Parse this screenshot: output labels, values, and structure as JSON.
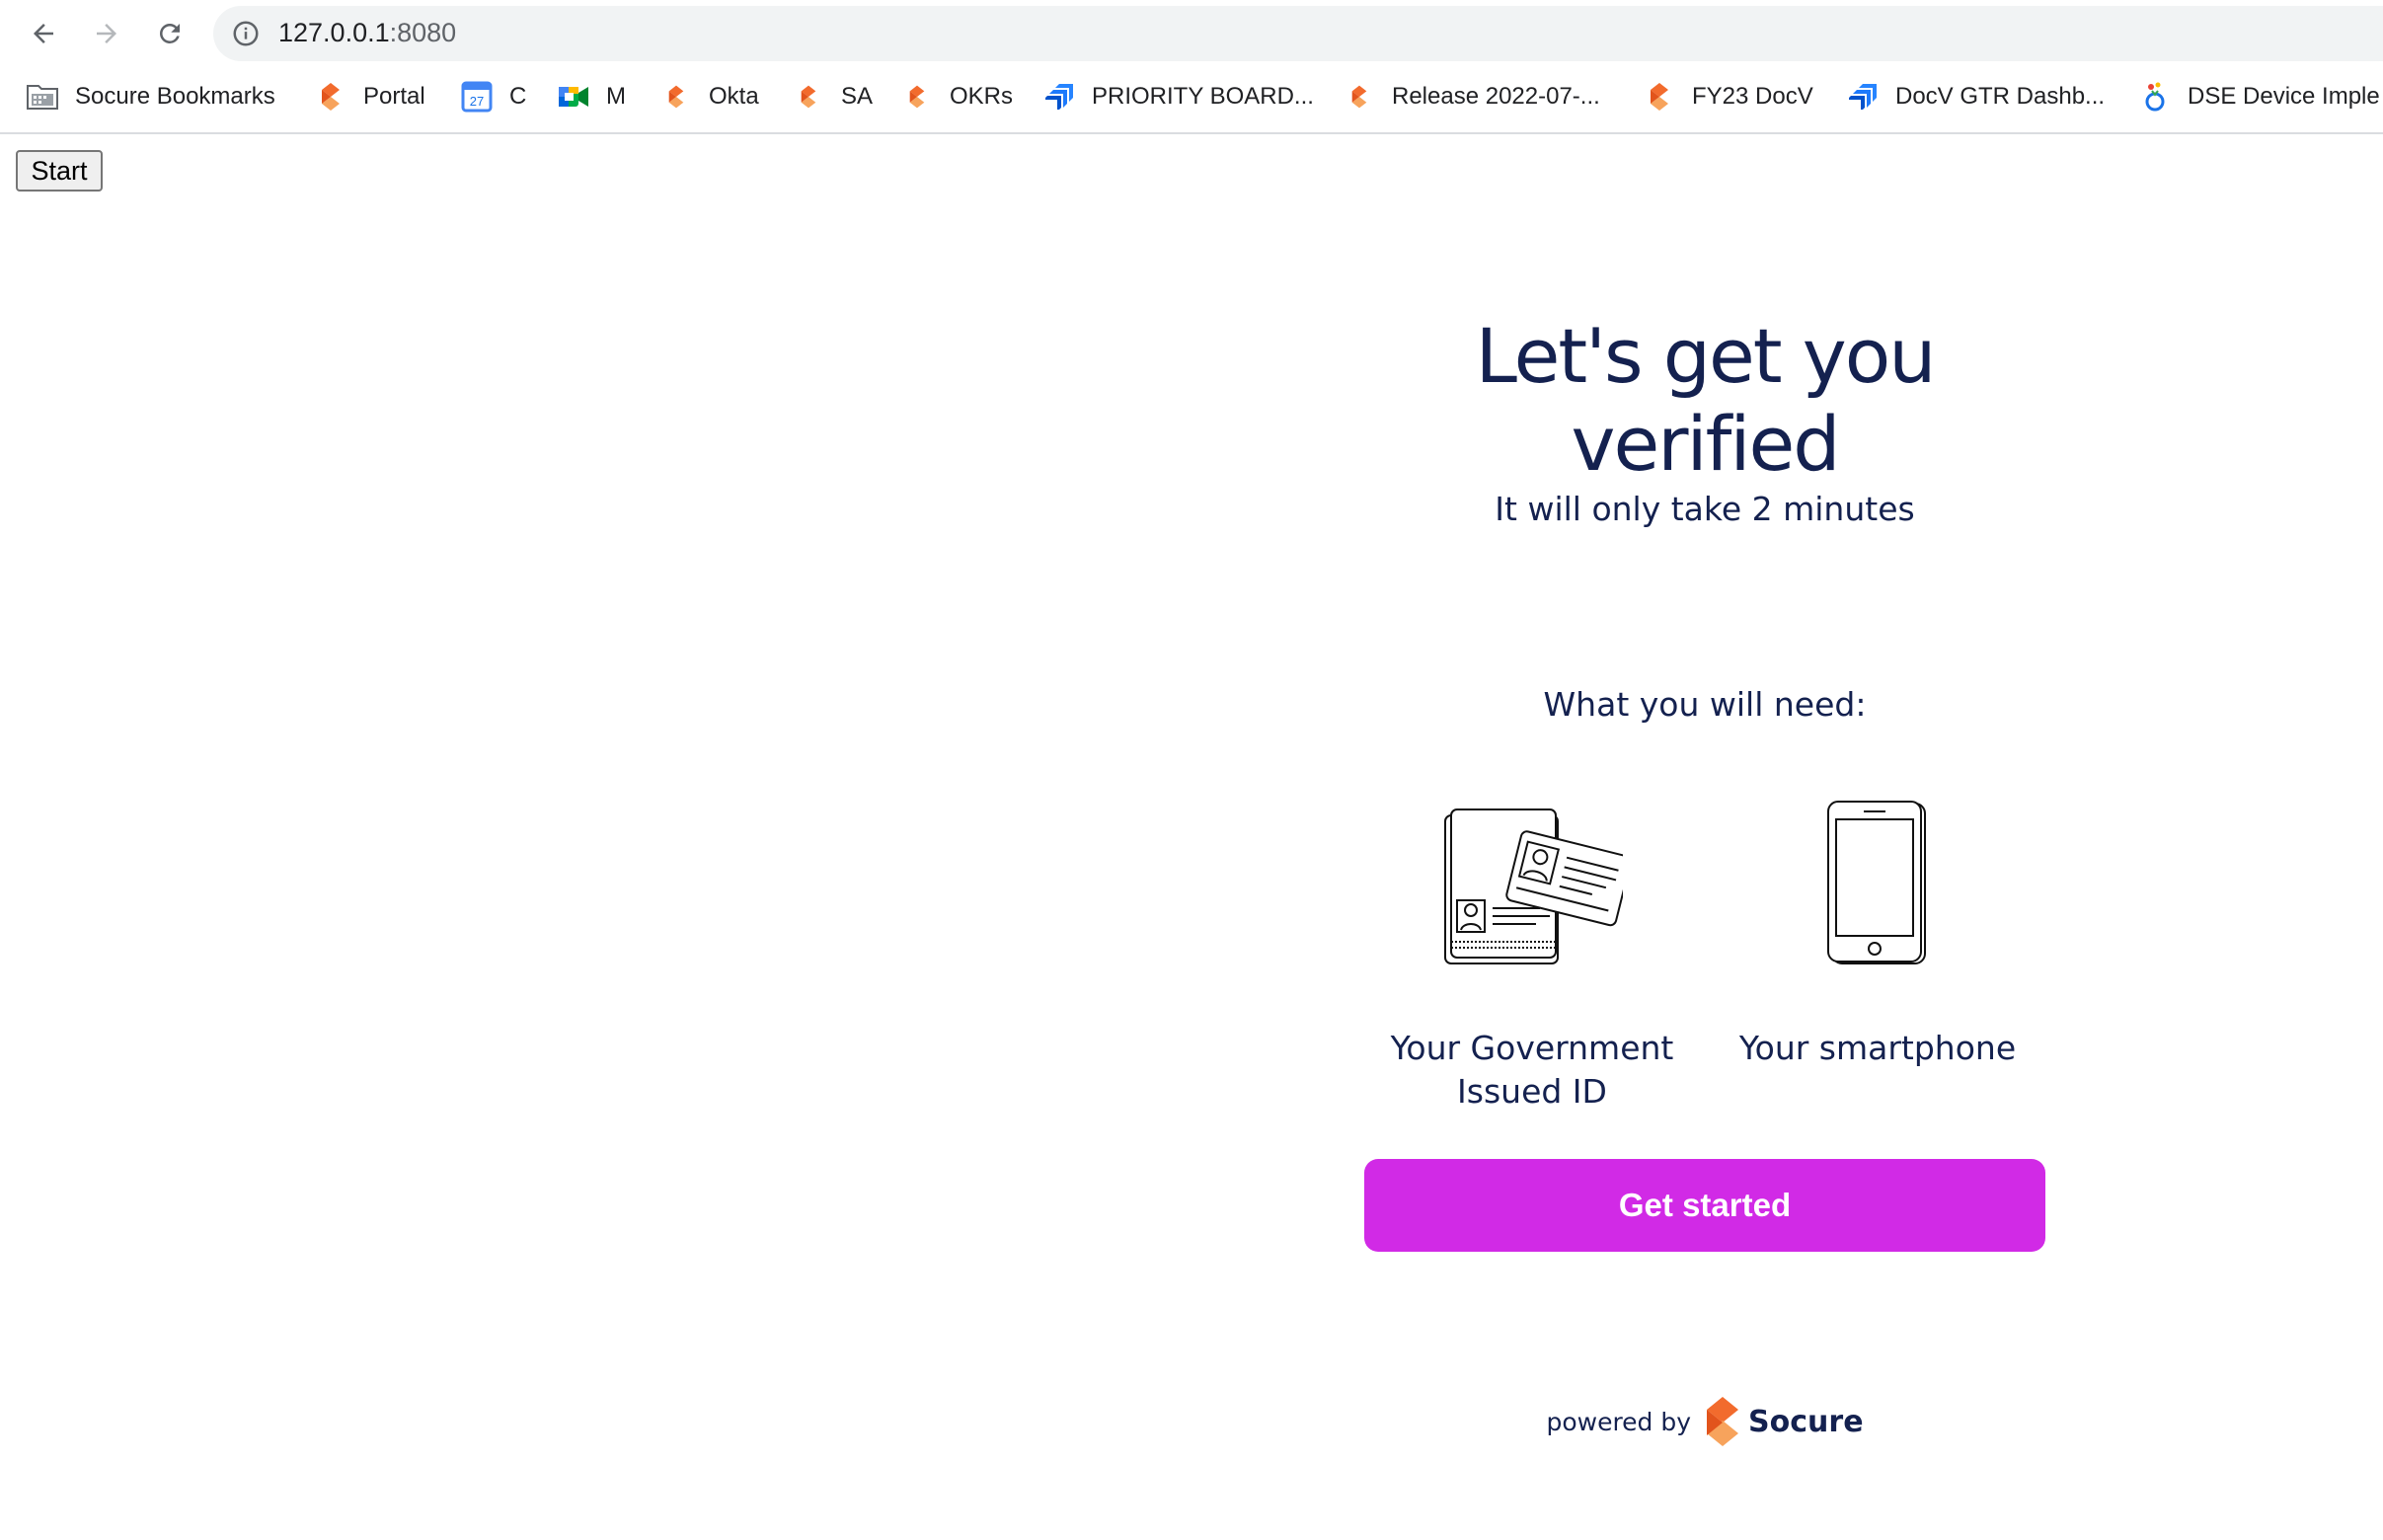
{
  "browser": {
    "url_host": "127.0.0.1",
    "url_port": ":8080",
    "icons": {
      "back": "back-arrow-icon",
      "forward": "forward-arrow-icon",
      "reload": "reload-icon",
      "site_info": "info-icon"
    }
  },
  "bookmarks": [
    {
      "label": "Socure Bookmarks",
      "icon": "folder-icon"
    },
    {
      "label": "Portal",
      "icon": "socure-icon"
    },
    {
      "label": "C",
      "icon": "calendar-icon",
      "icon_text": "27"
    },
    {
      "label": "M",
      "icon": "meet-icon"
    },
    {
      "label": "Okta",
      "icon": "socure-icon"
    },
    {
      "label": "SA",
      "icon": "socure-icon"
    },
    {
      "label": "OKRs",
      "icon": "socure-icon"
    },
    {
      "label": "PRIORITY BOARD...",
      "icon": "jira-icon"
    },
    {
      "label": "Release 2022-07-...",
      "icon": "socure-icon"
    },
    {
      "label": "FY23 DocV",
      "icon": "socure-icon"
    },
    {
      "label": "DocV GTR Dashb...",
      "icon": "jira-icon"
    },
    {
      "label": "DSE Device Imple",
      "icon": "device-icon"
    }
  ],
  "page": {
    "start_button": "Start",
    "title": "Let's get you verified",
    "subtitle": "It will only take 2 minutes",
    "need_heading": "What you will need:",
    "requirements": [
      {
        "label_line1": "Your Government",
        "label_line2": "Issued ID",
        "icon": "id-documents-icon"
      },
      {
        "label_line1": "Your smartphone",
        "label_line2": "",
        "icon": "smartphone-icon"
      }
    ],
    "cta": "Get started",
    "powered_by": "powered by",
    "brand": "Socure"
  },
  "colors": {
    "accent": "#d12ae6",
    "text": "#14214f",
    "brand_orange": "#f26b2d",
    "brand_orange_light": "#f7a35c"
  }
}
